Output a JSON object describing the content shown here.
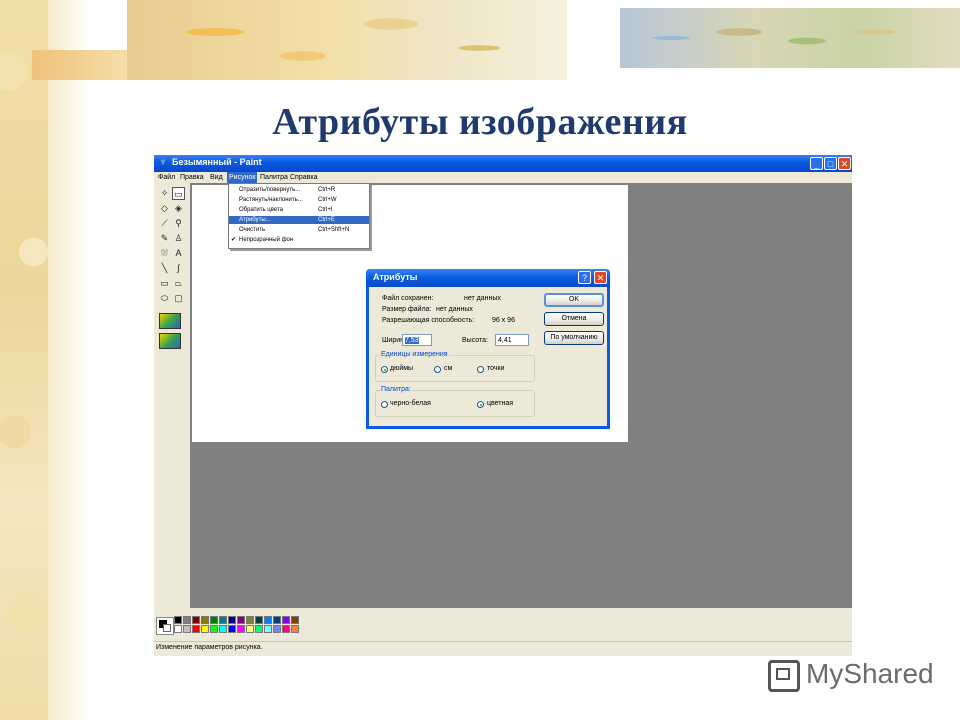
{
  "slide": {
    "title": "Атрибуты изображения"
  },
  "window": {
    "title": "Безымянный - Paint",
    "buttons": {
      "minimize": "_",
      "maximize": "□",
      "close": "✕"
    }
  },
  "menu": {
    "items": [
      "Файл",
      "Правка",
      "Вид",
      "Рисунок",
      "Палитра",
      "Справка"
    ],
    "active_index": 3
  },
  "image_menu": {
    "items": [
      {
        "label": "Отразить/повернуть...",
        "shortcut": "Ctrl+R"
      },
      {
        "label": "Растянуть/наклонить...",
        "shortcut": "Ctrl+W"
      },
      {
        "label": "Обратить цвета",
        "shortcut": "Ctrl+I"
      },
      {
        "label": "Атрибуты...",
        "shortcut": "Ctrl+E"
      },
      {
        "label": "Очистить",
        "shortcut": "Ctrl+Shft+N"
      },
      {
        "label": "Непрозрачный фон",
        "shortcut": ""
      }
    ],
    "highlighted_index": 3,
    "checked_mark": "✔"
  },
  "tools": [
    {
      "icon": "free-select-icon",
      "glyph": "✧"
    },
    {
      "icon": "rect-select-icon",
      "glyph": "▭"
    },
    {
      "icon": "eraser-icon",
      "glyph": "◇"
    },
    {
      "icon": "fill-icon",
      "glyph": "◈"
    },
    {
      "icon": "color-picker-icon",
      "glyph": "⟋"
    },
    {
      "icon": "magnifier-icon",
      "glyph": "⚲"
    },
    {
      "icon": "pencil-icon",
      "glyph": "✎"
    },
    {
      "icon": "brush-icon",
      "glyph": "♙"
    },
    {
      "icon": "airbrush-icon",
      "glyph": "⛆"
    },
    {
      "icon": "text-icon",
      "glyph": "A"
    },
    {
      "icon": "line-icon",
      "glyph": "╲"
    },
    {
      "icon": "curve-icon",
      "glyph": "∫"
    },
    {
      "icon": "rectangle-icon",
      "glyph": "▭"
    },
    {
      "icon": "polygon-icon",
      "glyph": "⏢"
    },
    {
      "icon": "ellipse-icon",
      "glyph": "⬭"
    },
    {
      "icon": "rounded-rect-icon",
      "glyph": "▢"
    }
  ],
  "dialog": {
    "title": "Атрибуты",
    "help": "?",
    "close": "✕",
    "file_saved_label": "Файл сохранен:",
    "file_saved_value": "нет данных",
    "file_size_label": "Размер файла:",
    "file_size_value": "нет данных",
    "resolution_label": "Разрешающая способность:",
    "resolution_value": "96 x 96",
    "width_label": "Ширина:",
    "width_value": "7,53",
    "height_label": "Высота:",
    "height_value": "4,41",
    "units": {
      "label": "Единицы измерения",
      "options": [
        "дюймы",
        "см",
        "точки"
      ],
      "selected_index": 0
    },
    "palette": {
      "label": "Палитра:",
      "options": [
        "черно-белая",
        "цветная"
      ],
      "selected_index": 1
    },
    "buttons": {
      "ok": "OK",
      "cancel": "Отмена",
      "default": "По умолчанию"
    }
  },
  "palette_colors": {
    "top": [
      "#000000",
      "#808080",
      "#800000",
      "#808000",
      "#008000",
      "#008080",
      "#000080",
      "#800080",
      "#808040",
      "#004040",
      "#0080ff",
      "#004080",
      "#8000ff",
      "#804000"
    ],
    "bottom": [
      "#ffffff",
      "#c0c0c0",
      "#ff0000",
      "#ffff00",
      "#00ff00",
      "#00ffff",
      "#0000ff",
      "#ff00ff",
      "#ffff80",
      "#00ff80",
      "#80ffff",
      "#8080ff",
      "#ff0080",
      "#ff8040"
    ]
  },
  "status": {
    "text": "Изменение параметров рисунка."
  },
  "logo": {
    "text": "MyShared"
  }
}
